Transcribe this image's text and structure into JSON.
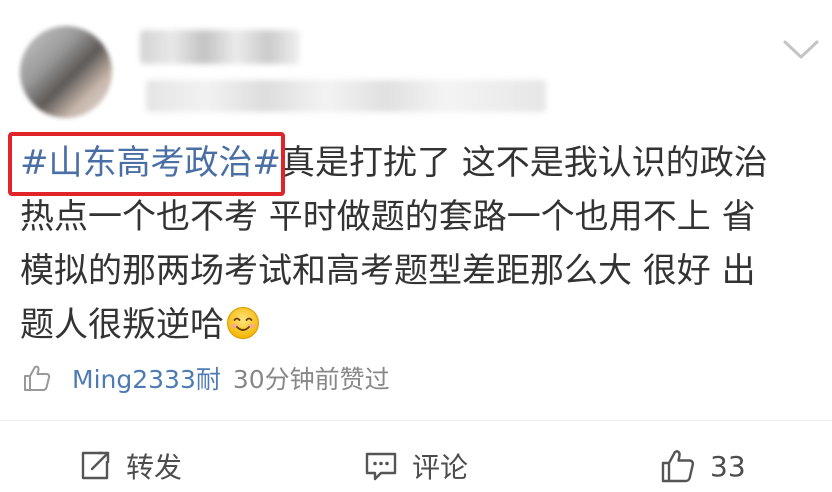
{
  "post": {
    "content": {
      "topic_tag": "#山东高考政治#",
      "lines": [
        "真是打扰了 这不是我认识的政治",
        "热点一个也不考 平时做题的套路一个也用不上 省",
        "模拟的那两场考试和高考题型差距那么大 很好 出",
        "题人很叛逆哈"
      ],
      "emoji": "smiling-face-emoji"
    },
    "liked_by": {
      "user": "Ming2333耐",
      "note": "30分钟前赞过"
    },
    "actions": {
      "repost_label": "转发",
      "comment_label": "评论",
      "like_count": "33"
    }
  },
  "colors": {
    "topic_link": "#4a6fa5",
    "highlight_box": "#e0242a",
    "user_link": "#4f7bb4",
    "muted_text": "#888888"
  }
}
